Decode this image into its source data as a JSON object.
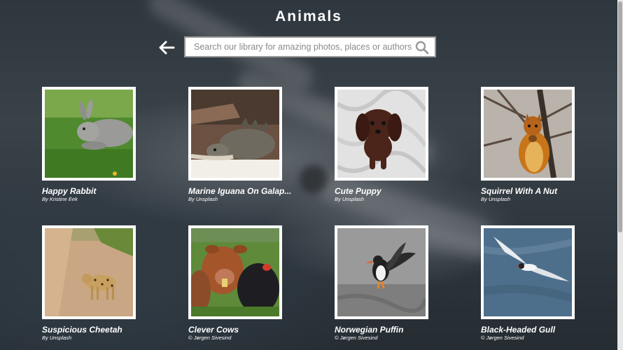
{
  "header": {
    "title": "Animals"
  },
  "search": {
    "placeholder": "Search our library for amazing photos, places or authors",
    "value": ""
  },
  "icons": {
    "back": "arrow-left-icon",
    "search": "search-icon"
  },
  "photos": [
    {
      "name": "Happy Rabbit",
      "author": "By Kristine Eek"
    },
    {
      "name": "Marine Iguana On Galap...",
      "author": "By Unsplash"
    },
    {
      "name": "Cute Puppy",
      "author": "By Unsplash"
    },
    {
      "name": "Squirrel With A Nut",
      "author": "By Unsplash"
    },
    {
      "name": "Suspicious Cheetah",
      "author": "By Unsplash"
    },
    {
      "name": "Clever Cows",
      "author": "© Jørgen Sivesind"
    },
    {
      "name": "Norwegian Puffin",
      "author": "© Jørgen Sivesind"
    },
    {
      "name": "Black-Headed Gull",
      "author": "© Jørgen Sivesind"
    }
  ]
}
